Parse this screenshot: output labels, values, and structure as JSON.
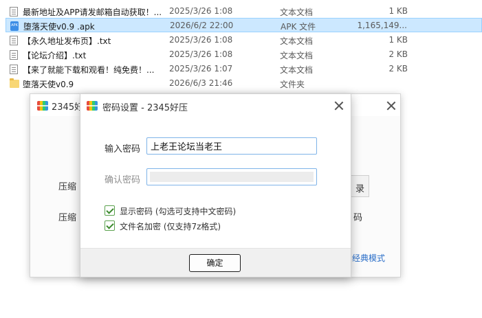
{
  "file_list": [
    {
      "name": "最新地址及APP请发邮箱自动获取！...",
      "date": "2025/3/26 1:08",
      "type": "文本文档",
      "size": "1 KB",
      "icon": "text-file-icon",
      "selected": false
    },
    {
      "name": "堕落天使v0.9 .apk",
      "date": "2026/6/2 22:00",
      "type": "APK 文件",
      "size": "1,165,149...",
      "icon": "apk-file-icon",
      "selected": true
    },
    {
      "name": "【永久地址发布页】.txt",
      "date": "2025/3/26 1:08",
      "type": "文本文档",
      "size": "1 KB",
      "icon": "text-file-icon",
      "selected": false
    },
    {
      "name": "【论坛介绍】.txt",
      "date": "2025/3/26 1:08",
      "type": "文本文档",
      "size": "2 KB",
      "icon": "text-file-icon",
      "selected": false
    },
    {
      "name": "【来了就能下载和观看！纯免费！...",
      "date": "2025/3/26 1:07",
      "type": "文本文档",
      "size": "2 KB",
      "icon": "text-file-icon",
      "selected": false
    },
    {
      "name": "堕落天使v0.9",
      "date": "2026/6/3 21:46",
      "type": "文件夹",
      "size": "",
      "icon": "folder-icon",
      "selected": false
    }
  ],
  "bg_dialog": {
    "title": "2345好",
    "label1": "压缩",
    "label2": "压缩",
    "button_text": "录",
    "text_right": "码",
    "link": "经典模式"
  },
  "pw_dialog": {
    "title": "密码设置 - 2345好压",
    "password_label": "输入密码",
    "password_value": "上老王论坛当老王",
    "confirm_label": "确认密码",
    "show_password_label": "显示密码 (勾选可支持中文密码)",
    "encrypt_filename_label": "文件名加密  (仅支持7z格式)",
    "show_password_checked": true,
    "encrypt_filename_checked": true,
    "ok_label": "确定"
  }
}
